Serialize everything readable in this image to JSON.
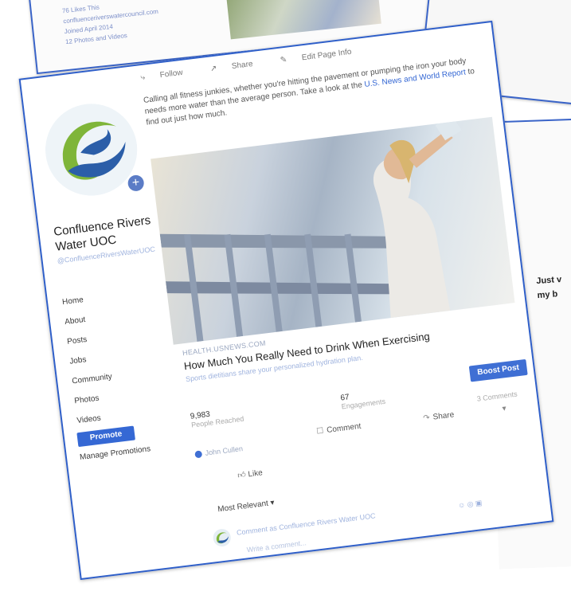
{
  "background": {
    "page_stats": [
      "76 Likes This",
      "confluenceriverswatercouncil.com",
      "Joined April 2014",
      "12 Photos and Videos"
    ]
  },
  "sidebar": {
    "org_name": "Confluence Rivers Water UOC",
    "handle": "@ConfluenceRiversWaterUOC",
    "nav_items": [
      "Home",
      "About",
      "Posts",
      "Jobs",
      "Community",
      "Photos",
      "Videos"
    ],
    "promote_label": "Promote",
    "manage_promotions_label": "Manage Promotions"
  },
  "actions": {
    "follow": "Follow",
    "share": "Share",
    "edit_page_info": "Edit Page Info"
  },
  "post": {
    "text_lead": "Calling all fitness junkies, whether you're hitting the pavement or pumping the iron your body needs more water than the average person. Take a look at the ",
    "text_link": "U.S. News and World Report",
    "text_tail": " to find out just how much.",
    "link_domain": "HEALTH.USNEWS.COM",
    "link_title": "How Much You Really Need to Drink When Exercising",
    "link_desc": "Sports dietitians share your personalized hydration plan.",
    "boost_label": "Boost Post",
    "reached_value": "9,983",
    "reached_label": "People Reached",
    "engagements_value": "67",
    "engagements_label": "Engagements",
    "comments_count": "3 Comments",
    "author": "John Cullen",
    "comment_label": "Comment",
    "share_label": "Share",
    "like_label": "Like",
    "most_relevant": "Most Relevant",
    "comment_as": "Comment as Confluence Rivers Water UOC",
    "write_comment": "Write a comment..."
  },
  "side_text": {
    "line1": "Just v",
    "line2": "my b"
  },
  "colors": {
    "frame_blue": "#2f5fc9",
    "button_blue": "#3568d4",
    "logo_green": "#7fb539",
    "logo_blue": "#2b5ea8"
  },
  "icons": [
    "follow-icon",
    "share-icon",
    "edit-icon",
    "plus-icon",
    "comment-icon",
    "like-icon",
    "dropdown-icon"
  ]
}
